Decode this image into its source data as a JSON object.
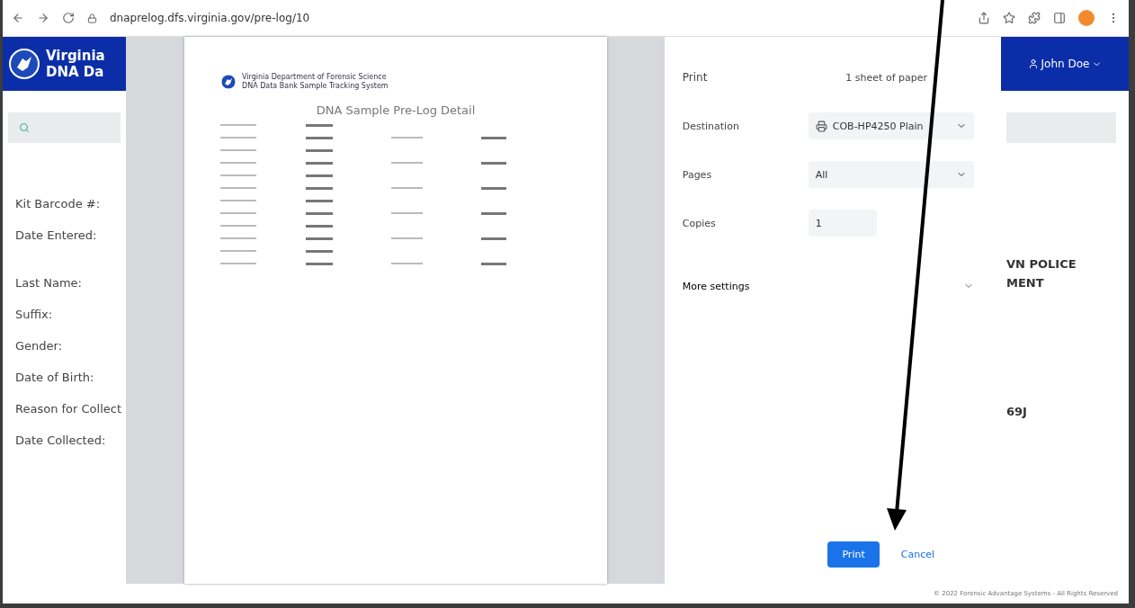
{
  "browser": {
    "url": "dnaprelog.dfs.virginia.gov/pre-log/10"
  },
  "app": {
    "header_lines": [
      "Virginia",
      "DNA Da"
    ],
    "user": "John Doe",
    "field_labels": [
      "Kit Barcode #:",
      "Date Entered:",
      "Last Name:",
      "Suffix:",
      "Gender:",
      "Date of Birth:",
      "Reason for Collect",
      "Date Collected:"
    ],
    "agency_lines": [
      "VN POLICE",
      "MENT"
    ],
    "barcode_fragment": "69J"
  },
  "print_dialog": {
    "preview": {
      "org_lines": [
        "Virginia Department of Forensic Science",
        "DNA Data Bank Sample Tracking System"
      ],
      "title": "DNA Sample Pre-Log Detail"
    },
    "title": "Print",
    "sheets": "1 sheet of paper",
    "rows": [
      {
        "label": "Destination",
        "value": "COB-HP4250 Plain",
        "kind": "printer"
      },
      {
        "label": "Pages",
        "value": "All",
        "kind": "select"
      },
      {
        "label": "Copies",
        "value": "1",
        "kind": "input"
      }
    ],
    "more_settings": "More settings",
    "buttons": [
      {
        "label": "Print",
        "kind": "primary"
      },
      {
        "label": "Cancel",
        "kind": "link"
      }
    ]
  },
  "footer": "© 2022 Forensic Advantage Systems - All Rights Reserved"
}
